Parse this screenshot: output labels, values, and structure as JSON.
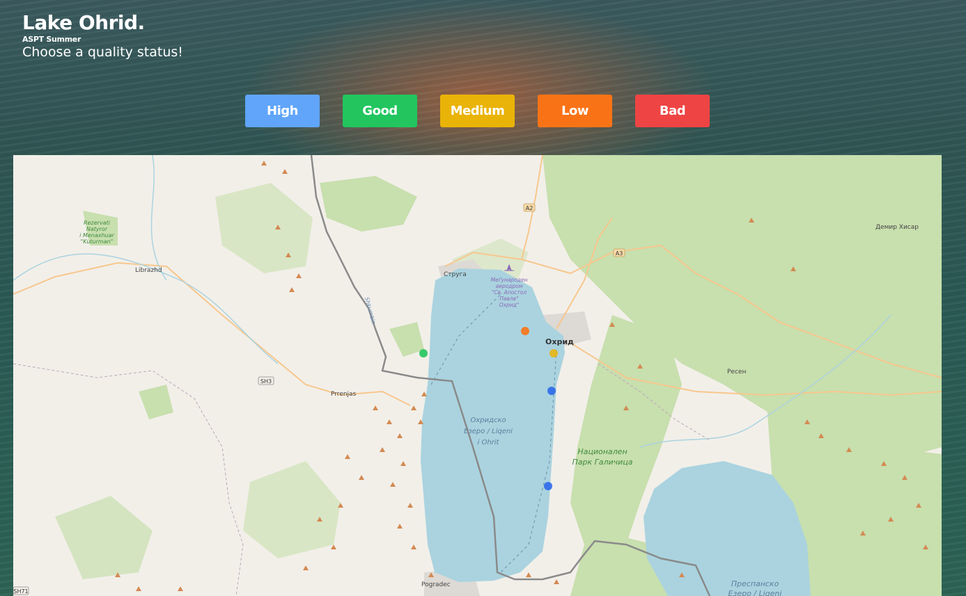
{
  "header": {
    "title": "Lake Ohrid.",
    "subtitle": "ASPT Summer",
    "prompt": "Choose a quality status!"
  },
  "quality_buttons": [
    {
      "label": "High",
      "color": "#60a5fa"
    },
    {
      "label": "Good",
      "color": "#22c55e"
    },
    {
      "label": "Medium",
      "color": "#eab308"
    },
    {
      "label": "Low",
      "color": "#f97316"
    },
    {
      "label": "Bad",
      "color": "#ef4444"
    }
  ],
  "map": {
    "labels": {
      "rezervati": [
        "Rezervati",
        "Natyror",
        "i Menaxhuar",
        "\"Kuturman\""
      ],
      "librazhd": "Librazhd",
      "struga": "Струга",
      "airport": [
        "Меѓународен",
        "аеродром",
        "\"Св. Апостол",
        "Павле\"",
        "Охрид\""
      ],
      "ohrid": "Охрид",
      "shkumbin": "Shkumbin",
      "sh3": "SH3",
      "prrenjas": "Prrenjas",
      "lake_ohrid": [
        "Охридско",
        "Езеро / Liqeni",
        "i Ohrit"
      ],
      "national_park": [
        "Национален",
        "Парк Галичица"
      ],
      "resen": "Ресен",
      "demir_hisar": "Демир Хисар",
      "a2": "A2",
      "a3": "A3",
      "pogradec": "Pogradec",
      "sh71": "SH71",
      "prespa": [
        "Преспанско",
        "Езеро / Ligeni"
      ]
    },
    "markers": [
      {
        "status": "Low",
        "color": "#f97316"
      },
      {
        "status": "Good",
        "color": "#22c55e"
      },
      {
        "status": "Medium",
        "color": "#eab308"
      },
      {
        "status": "High",
        "color": "#2563eb"
      },
      {
        "status": "High",
        "color": "#2563eb"
      }
    ]
  }
}
